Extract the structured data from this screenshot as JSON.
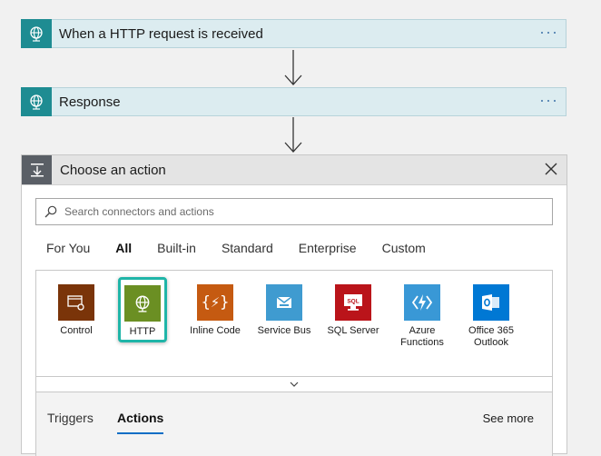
{
  "flow": {
    "trigger": {
      "title": "When a HTTP request is received",
      "icon": "globe-icon",
      "more": "···"
    },
    "response": {
      "title": "Response",
      "icon": "globe-icon",
      "more": "···"
    }
  },
  "choose_action": {
    "title": "Choose an action",
    "icon": "action-icon",
    "search": {
      "placeholder": "Search connectors and actions",
      "value": ""
    },
    "tabs": [
      "For You",
      "All",
      "Built-in",
      "Standard",
      "Enterprise",
      "Custom"
    ],
    "active_tab": "All",
    "connectors": [
      {
        "label": "Control",
        "icon": "control-icon",
        "color": "#7a3409"
      },
      {
        "label": "HTTP",
        "icon": "globe-icon",
        "color": "#6b8f23",
        "selected": true
      },
      {
        "label": "Inline Code",
        "icon": "code-braces-icon",
        "color": "#c55a11"
      },
      {
        "label": "Service Bus",
        "icon": "service-bus-icon",
        "color": "#3f9bd0"
      },
      {
        "label": "SQL Server",
        "icon": "sql-icon",
        "color": "#ba141a"
      },
      {
        "label": "Azure\nFunctions",
        "icon": "azure-functions-icon",
        "color": "#3998d6"
      },
      {
        "label": "Office 365\nOutlook",
        "icon": "outlook-icon",
        "color": "#0078d4"
      }
    ],
    "subtabs": [
      "Triggers",
      "Actions"
    ],
    "active_subtab": "Actions",
    "see_more": "See more"
  },
  "colors": {
    "teal": "#1e8c92",
    "accent": "#0c6ec5",
    "highlight": "#1fb5a8"
  }
}
